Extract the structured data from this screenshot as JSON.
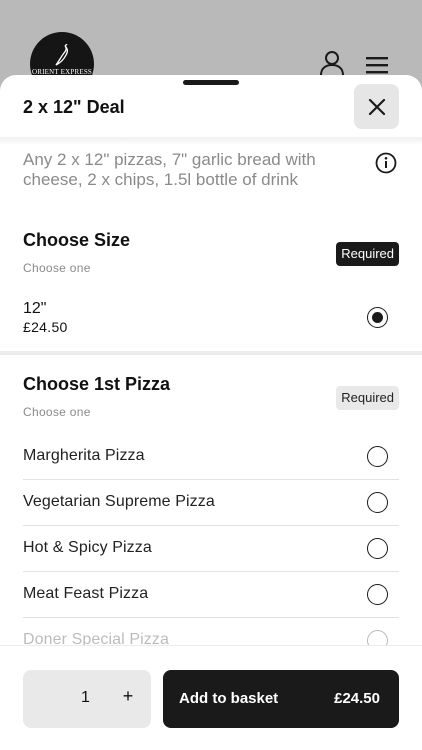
{
  "background": {
    "logo_text": "ORIENT EXPRESS",
    "account_icon": "user-icon",
    "menu_icon": "hamburger-menu-icon"
  },
  "modal": {
    "title": "2 x 12\" Deal",
    "close_icon": "close-icon",
    "description": "Any 2 x 12\" pizzas, 7\" garlic bread with cheese, 2 x chips, 1.5l bottle of drink",
    "info_icon": "info-icon"
  },
  "size_section": {
    "title": "Choose Size",
    "subtitle": "Choose one",
    "badge": "Required",
    "option": {
      "name": "12\"",
      "price": "£24.50",
      "selected": true
    }
  },
  "pizza_section": {
    "title": "Choose 1st Pizza",
    "subtitle": "Choose one",
    "badge": "Required",
    "options": [
      {
        "label": "Margherita Pizza",
        "selected": false
      },
      {
        "label": "Vegetarian Supreme Pizza",
        "selected": false
      },
      {
        "label": "Hot & Spicy Pizza",
        "selected": false
      },
      {
        "label": "Meat Feast Pizza",
        "selected": false
      },
      {
        "label": "Doner Special Pizza",
        "selected": false
      }
    ]
  },
  "footer": {
    "quantity": "1",
    "plus_label": "+",
    "add_label": "Add to basket",
    "add_price": "£24.50"
  },
  "colors": {
    "primary": "#1a1a1a",
    "muted_text": "#8a8a8a",
    "badge_light": "#e9e9e9"
  }
}
